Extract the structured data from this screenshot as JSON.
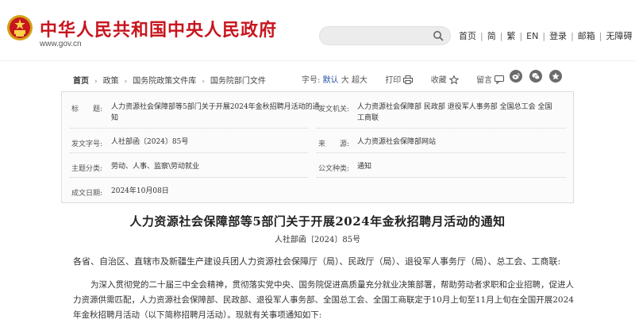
{
  "header": {
    "site_title": "中华人民共和国中央人民政府",
    "site_url": "www.gov.cn",
    "search_placeholder": "",
    "links": [
      "首页",
      "简",
      "繁",
      "EN",
      "登录",
      "邮箱",
      "无障碍"
    ],
    "brand_color": "#c8161e"
  },
  "breadcrumb": {
    "items": [
      "首页",
      "政策",
      "国务院政策文件库",
      "国务院部门文件"
    ]
  },
  "tools": {
    "font_size_label": "字号:",
    "sizes": [
      "默认",
      "大",
      "超大"
    ],
    "print": "打印",
    "favorite": "收藏",
    "comment": "留言"
  },
  "share_icons": [
    "weibo-icon",
    "wechat-icon",
    "qzone-icon"
  ],
  "meta": {
    "title_label": "标　　题:",
    "title_value_line1": "人力资源社会保障部等5部门关于开展2024年金秋招聘月活动的通",
    "title_value_line2": "知",
    "issuer_label": "发文机关:",
    "issuer_value_line1": "人力资源社会保障部 民政部 退役军人事务部 全国总工会 全国",
    "issuer_value_line2": "工商联",
    "docno_label": "发文字号:",
    "docno_value": "人社部函〔2024〕85号",
    "source_label": "来　　源:",
    "source_value": "人力资源社会保障部网站",
    "category_label": "主题分类:",
    "category_value": "劳动、人事、监察\\劳动就业",
    "doctype_label": "公文种类:",
    "doctype_value": "通知",
    "date_label": "成文日期:",
    "date_value": "2024年10月08日"
  },
  "article": {
    "title": "人力资源社会保障部等5部门关于开展2024年金秋招聘月活动的通知",
    "doc_number": "人社部函〔2024〕85号",
    "salutation": "各省、自治区、直辖市及新疆生产建设兵团人力资源社会保障厅（局）、民政厅（局）、退役军人事务厅（局）、总工会、工商联:",
    "paragraph1": "为深入贯彻党的二十届三中全会精神，贯彻落实党中央、国务院促进高质量充分就业决策部署，帮助劳动者求职和企业招聘，促进人力资源供需匹配，人力资源社会保障部、民政部、退役军人事务部、全国总工会、全国工商联定于10月上旬至11月上旬在全国开展2024年金秋招聘月活动（以下简称招聘月活动）。现就有关事项通知如下:"
  }
}
